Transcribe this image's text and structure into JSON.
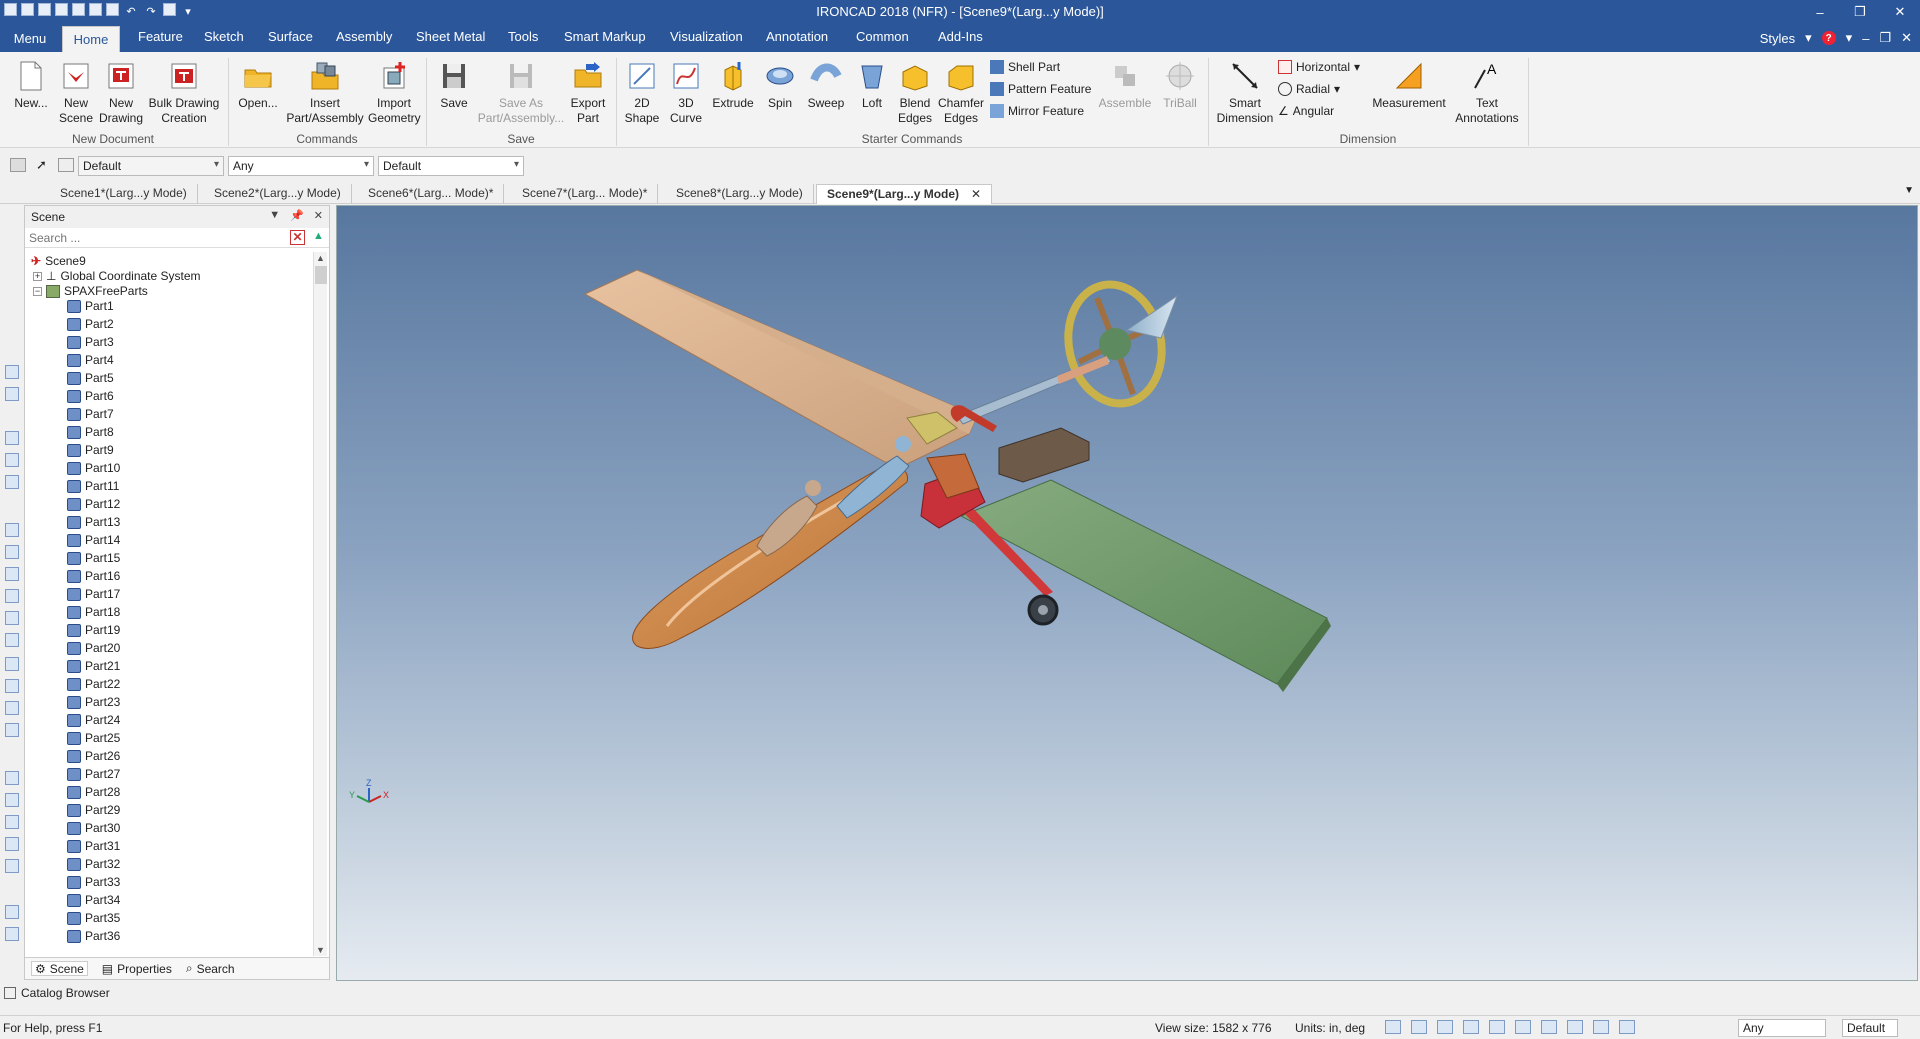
{
  "window": {
    "title": "IRONCAD 2018 (NFR) - [Scene9*(Larg...y Mode)]"
  },
  "menu_tabs": {
    "menu": "Menu",
    "home": "Home",
    "items": [
      "Feature",
      "Sketch",
      "Surface",
      "Assembly",
      "Sheet Metal",
      "Tools",
      "Smart Markup",
      "Visualization",
      "Annotation",
      "Common",
      "Add-Ins"
    ],
    "styles": "Styles"
  },
  "ribbon": {
    "new_document": {
      "label": "New Document",
      "new": "New...",
      "new_scene": "New\nScene",
      "new_drawing": "New\nDrawing",
      "bulk_drawing": "Bulk Drawing\nCreation"
    },
    "commands": {
      "label": "Commands",
      "open": "Open...",
      "insert": "Insert\nPart/Assembly",
      "import": "Import\nGeometry"
    },
    "save": {
      "label": "Save",
      "save": "Save",
      "save_as": "Save As\nPart/Assembly...",
      "export": "Export\nPart"
    },
    "starter": {
      "label": "Starter Commands",
      "shape2d": "2D\nShape",
      "curve3d": "3D\nCurve",
      "extrude": "Extrude",
      "spin": "Spin",
      "sweep": "Sweep",
      "loft": "Loft",
      "blend": "Blend\nEdges",
      "chamfer": "Chamfer\nEdges",
      "shell": "Shell Part",
      "pattern": "Pattern Feature",
      "mirror": "Mirror Feature",
      "assemble": "Assemble",
      "triball": "TriBall"
    },
    "dimension": {
      "label": "Dimension",
      "smart": "Smart\nDimension",
      "horizontal": "Horizontal",
      "radial": "Radial",
      "angular": "Angular",
      "measurement": "Measurement",
      "text": "Text\nAnnotations"
    }
  },
  "toolbar2": {
    "combo1": "Default",
    "combo2": "Any",
    "combo3": "Default"
  },
  "doc_tabs": [
    "Scene1*(Larg...y Mode)",
    "Scene2*(Larg...y Mode)",
    "Scene6*(Larg... Mode)*",
    "Scene7*(Larg... Mode)*",
    "Scene8*(Larg...y Mode)",
    "Scene9*(Larg...y Mode)"
  ],
  "scene_panel": {
    "title": "Scene",
    "search_placeholder": "Search ...",
    "root": "Scene9",
    "gcs": "Global Coordinate System",
    "group": "SPAXFreeParts",
    "parts": [
      "Part1",
      "Part2",
      "Part3",
      "Part4",
      "Part5",
      "Part6",
      "Part7",
      "Part8",
      "Part9",
      "Part10",
      "Part11",
      "Part12",
      "Part13",
      "Part14",
      "Part15",
      "Part16",
      "Part17",
      "Part18",
      "Part19",
      "Part20",
      "Part21",
      "Part22",
      "Part23",
      "Part24",
      "Part25",
      "Part26",
      "Part27",
      "Part28",
      "Part29",
      "Part30",
      "Part31",
      "Part32",
      "Part33",
      "Part34",
      "Part35",
      "Part36"
    ],
    "tabs": [
      "Scene",
      "Properties",
      "Search"
    ]
  },
  "catalog_browser": "Catalog Browser",
  "status": {
    "help": "For Help, press F1",
    "view_size": "View size: 1582 x  776",
    "units": "Units: in, deg",
    "combo_any": "Any",
    "combo_default": "Default"
  },
  "axis": {
    "x": "X",
    "y": "Y",
    "z": "Z"
  },
  "colors": {
    "title_bar": "#2b579a",
    "viewport_top": "#58779f",
    "viewport_bottom": "#e6ebf1"
  }
}
